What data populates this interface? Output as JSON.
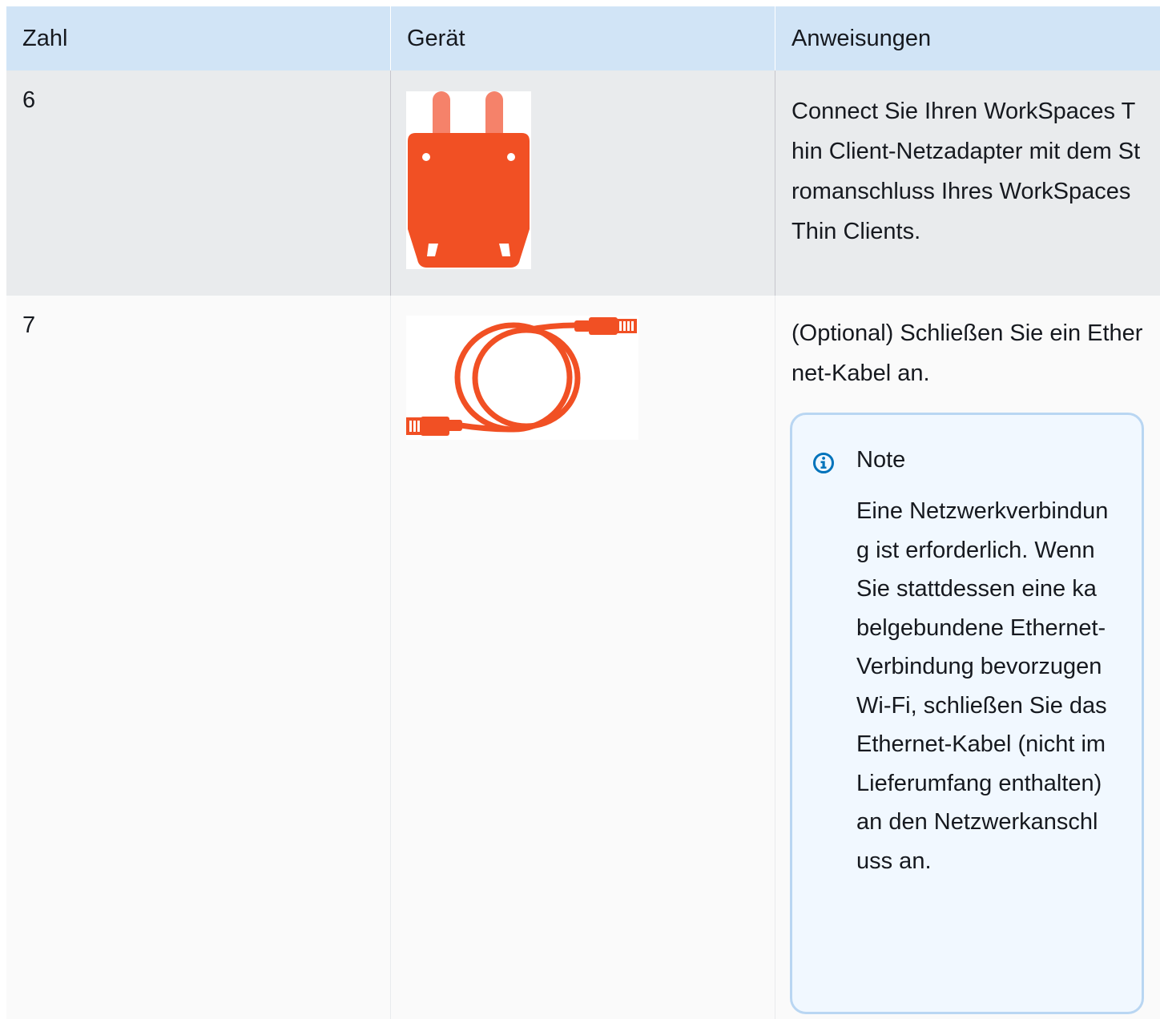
{
  "table": {
    "headers": {
      "number": "Zahl",
      "device": "Gerät",
      "instructions": "Anweisungen"
    },
    "rows": [
      {
        "number": "6",
        "device_icon": "power-plug-icon",
        "instructions": "Connect Sie Ihren WorkSpaces Thin Client-Netzadapter mit dem Stromanschluss Ihres WorkSpaces Thin Clients."
      },
      {
        "number": "7",
        "device_icon": "ethernet-cable-icon",
        "instructions": "(Optional) Schließen Sie ein Ethernet-Kabel an.",
        "note": {
          "icon": "info-icon",
          "title": "Note",
          "text": "Eine Netzwerkverbindung ist erforderlich. Wenn Sie stattdessen eine kabelgebundene Ethernet-Verbindung bevorzugen Wi-Fi, schließen Sie das Ethernet-Kabel (nicht im Lieferumfang enthalten) an den Netzwerkanschluss an."
        }
      }
    ]
  },
  "colors": {
    "header_bg": "#d1e4f6",
    "row_alt_bg": "#e9ebed",
    "row_bg": "#fafafa",
    "accent_orange": "#f15024",
    "note_border": "#b9d6f2",
    "note_bg": "#f1f8ff",
    "info_icon": "#0073bb"
  }
}
